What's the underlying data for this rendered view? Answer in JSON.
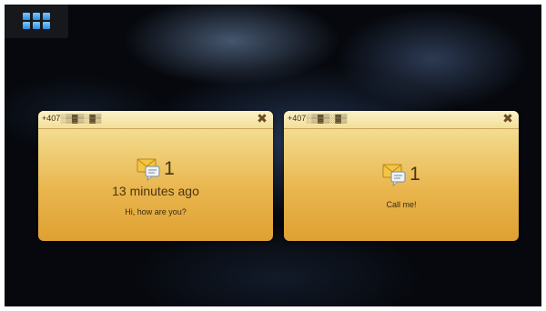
{
  "launcher": {
    "icon": "app-grid-icon"
  },
  "notifications": [
    {
      "sender": "+407░▒▓▒░▓▒",
      "close_icon": "close-icon",
      "message_icon": "sms-envelope-icon",
      "count": "1",
      "time": "13 minutes ago",
      "text": "Hi, how are you?"
    },
    {
      "sender": "+407░▒▓▒░▓▒",
      "close_icon": "close-icon",
      "message_icon": "sms-envelope-icon",
      "count": "1",
      "text": "Call me!"
    }
  ],
  "colors": {
    "card_top": "#f7e7a6",
    "card_bottom": "#dea032",
    "launcher_icon": "#2a8be0",
    "background": "#06080d"
  }
}
